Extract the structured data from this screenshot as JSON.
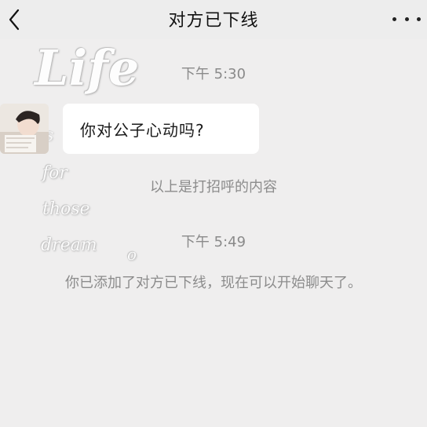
{
  "header": {
    "title": "对方已下线",
    "back_icon": "chevron-left-icon",
    "more_icon": "more-dots-icon"
  },
  "watermark": {
    "line1": "Life",
    "line2": "is",
    "line3": "for",
    "line4": "those",
    "line5": "dream"
  },
  "messages": {
    "time1": "下午 5:30",
    "bubble_text": "你对公子心动吗?",
    "system1": "以上是打招呼的内容",
    "time2": "下午 5:49",
    "system2": "你已添加了对方已下线，现在可以开始聊天了。"
  },
  "colors": {
    "background": "#efeeee",
    "bubble": "#ffffff",
    "meta_text": "#8a8a8a"
  }
}
